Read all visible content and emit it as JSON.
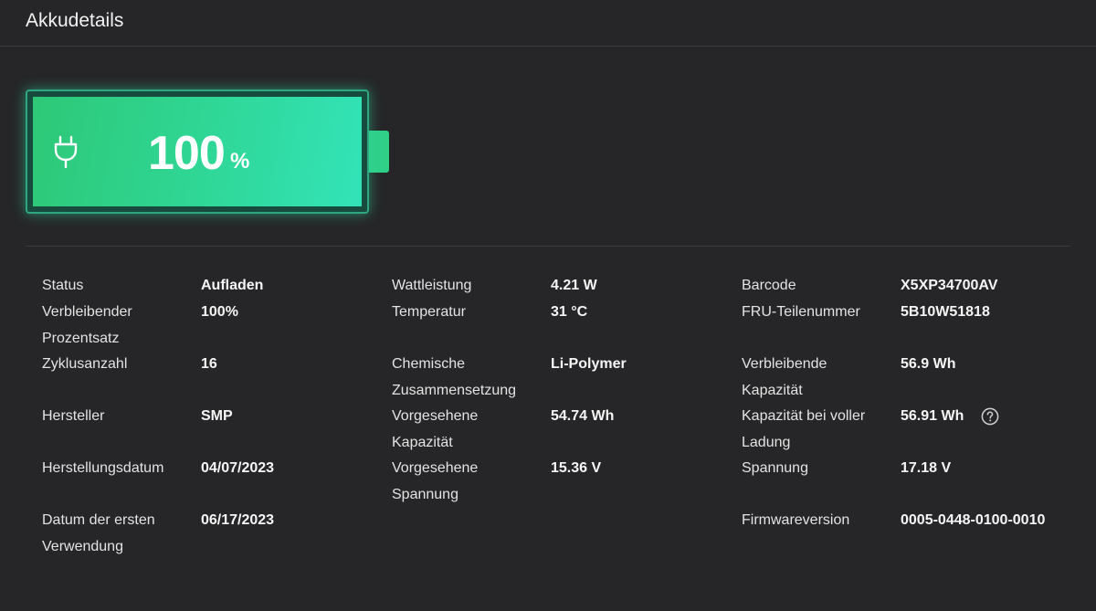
{
  "header": {
    "title": "Akkudetails"
  },
  "battery": {
    "value": "100",
    "unit": "%",
    "icon": "plug-icon",
    "fill_color": "#2fd694"
  },
  "columns": [
    {
      "rows": [
        {
          "label": "Status",
          "value": "Aufladen"
        },
        {
          "label": "Verbleibender Prozentsatz",
          "value": "100%"
        },
        {
          "label": "Zyklusanzahl",
          "value": "16"
        },
        {
          "label": "Hersteller",
          "value": "SMP"
        },
        {
          "label": "Herstellungsdatum",
          "value": "04/07/2023"
        },
        {
          "label": "Datum der ersten Verwendung",
          "value": "06/17/2023"
        }
      ]
    },
    {
      "rows": [
        {
          "label": "Wattleistung",
          "value": "4.21 W"
        },
        {
          "label": "Temperatur",
          "value": "31 °C"
        },
        {
          "label": "Chemische Zusammensetzung",
          "value": "Li-Polymer"
        },
        {
          "label": "Vorgesehene Kapazität",
          "value": "54.74 Wh"
        },
        {
          "label": "Vorgesehene Spannung",
          "value": "15.36 V"
        }
      ]
    },
    {
      "rows": [
        {
          "label": "Barcode",
          "value": "X5XP34700AV"
        },
        {
          "label": "FRU-Teilenummer",
          "value": "5B10W51818"
        },
        {
          "label": "Verbleibende Kapazität",
          "value": "56.9 Wh"
        },
        {
          "label": "Kapazität bei voller Ladung",
          "value": "56.91 Wh",
          "help_icon": "question-circle-icon"
        },
        {
          "label": "Spannung",
          "value": "17.18 V"
        },
        {
          "label": "Firmwareversion",
          "value": "0005-0448-0100-0010"
        }
      ]
    }
  ]
}
